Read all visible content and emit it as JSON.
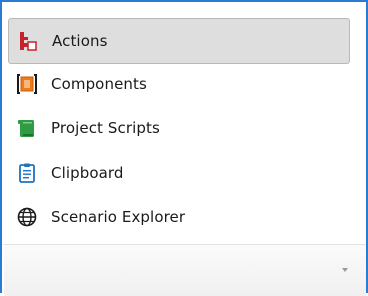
{
  "nav": {
    "items": [
      {
        "label": "Actions",
        "icon": "actions-icon",
        "selected": true
      },
      {
        "label": "Components",
        "icon": "components-icon",
        "selected": false
      },
      {
        "label": "Project Scripts",
        "icon": "project-scripts-icon",
        "selected": false
      },
      {
        "label": "Clipboard",
        "icon": "clipboard-icon",
        "selected": false
      },
      {
        "label": "Scenario Explorer",
        "icon": "globe-icon",
        "selected": false
      }
    ]
  },
  "colors": {
    "panel_border": "#2b7bd3",
    "selected_bg": "#dedede",
    "actions_icon": "#c6222b",
    "components_icon": "#ef7a1a",
    "scripts_icon": "#2f9b45",
    "clipboard_icon": "#1e73c2"
  }
}
